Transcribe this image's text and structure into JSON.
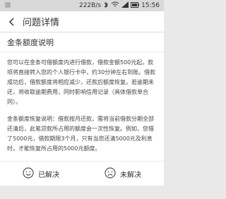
{
  "status_bar": {
    "net_speed": "222B/s",
    "time": "15:56"
  },
  "header": {
    "title": "问题详情"
  },
  "section": {
    "title": "金条额度说明"
  },
  "content": {
    "paragraphs": [
      "您可以在金条可借额度内进行借款，借款金额500元起，款项将直接转入您的个人银行卡中，约30分钟左右到账。借款成功后，借款额度将相应减少，还款后额度恢复。若逾期未还，将收取逾期费用，同时影响信用记录（具体借款单合同）。",
      "金条额度恢复说明：借款按月还款，需将当前借款分期全部还清后，此笔贷款所占用的额度会一次性恢复。例如，您借了5000元，借款期限3个月，只有当您还清5000元及利息时，才能恢复所占用的5000元额度。"
    ]
  },
  "feedback": {
    "resolved_label": "已解决",
    "unresolved_label": "未解决"
  },
  "colors": {
    "accent": "#e8434a",
    "resolved_icon": "#555555"
  }
}
